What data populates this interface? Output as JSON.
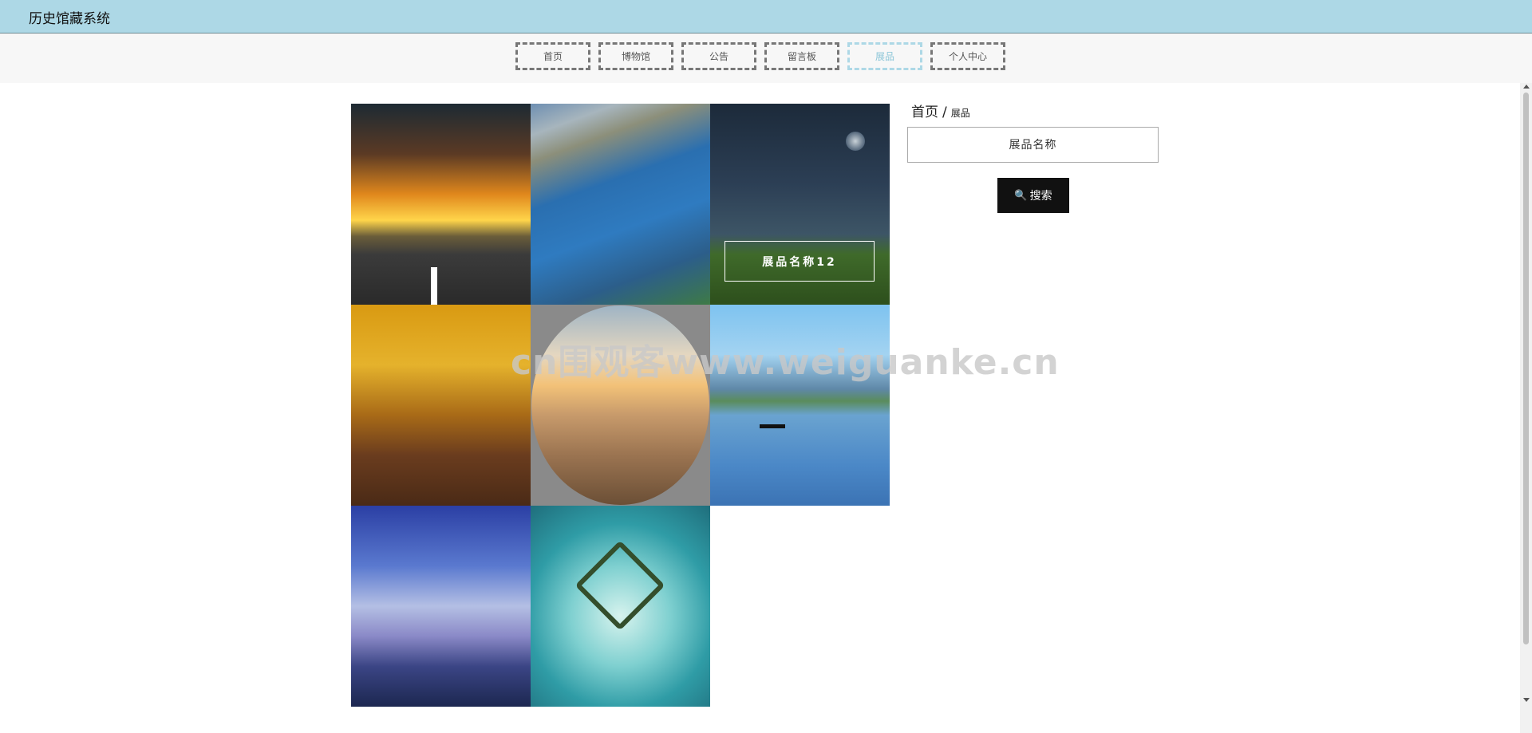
{
  "app": {
    "title": "历史馆藏系统"
  },
  "nav": {
    "items": [
      {
        "label": "首页"
      },
      {
        "label": "博物馆"
      },
      {
        "label": "公告"
      },
      {
        "label": "留言板"
      },
      {
        "label": "展品"
      },
      {
        "label": "个人中心"
      }
    ],
    "active_index": 4
  },
  "gallery": {
    "hover_caption": "展品名称12"
  },
  "watermark": "cn围观客www.weiguanke.cn",
  "breadcrumb": {
    "home": "首页",
    "separator": "/",
    "current": "展品"
  },
  "search": {
    "placeholder": "展品名称",
    "button_label": "搜索",
    "button_icon": "search-icon"
  },
  "colors": {
    "header_bg": "#add8e6",
    "active_nav": "#add8e6",
    "button_bg": "#111111"
  }
}
